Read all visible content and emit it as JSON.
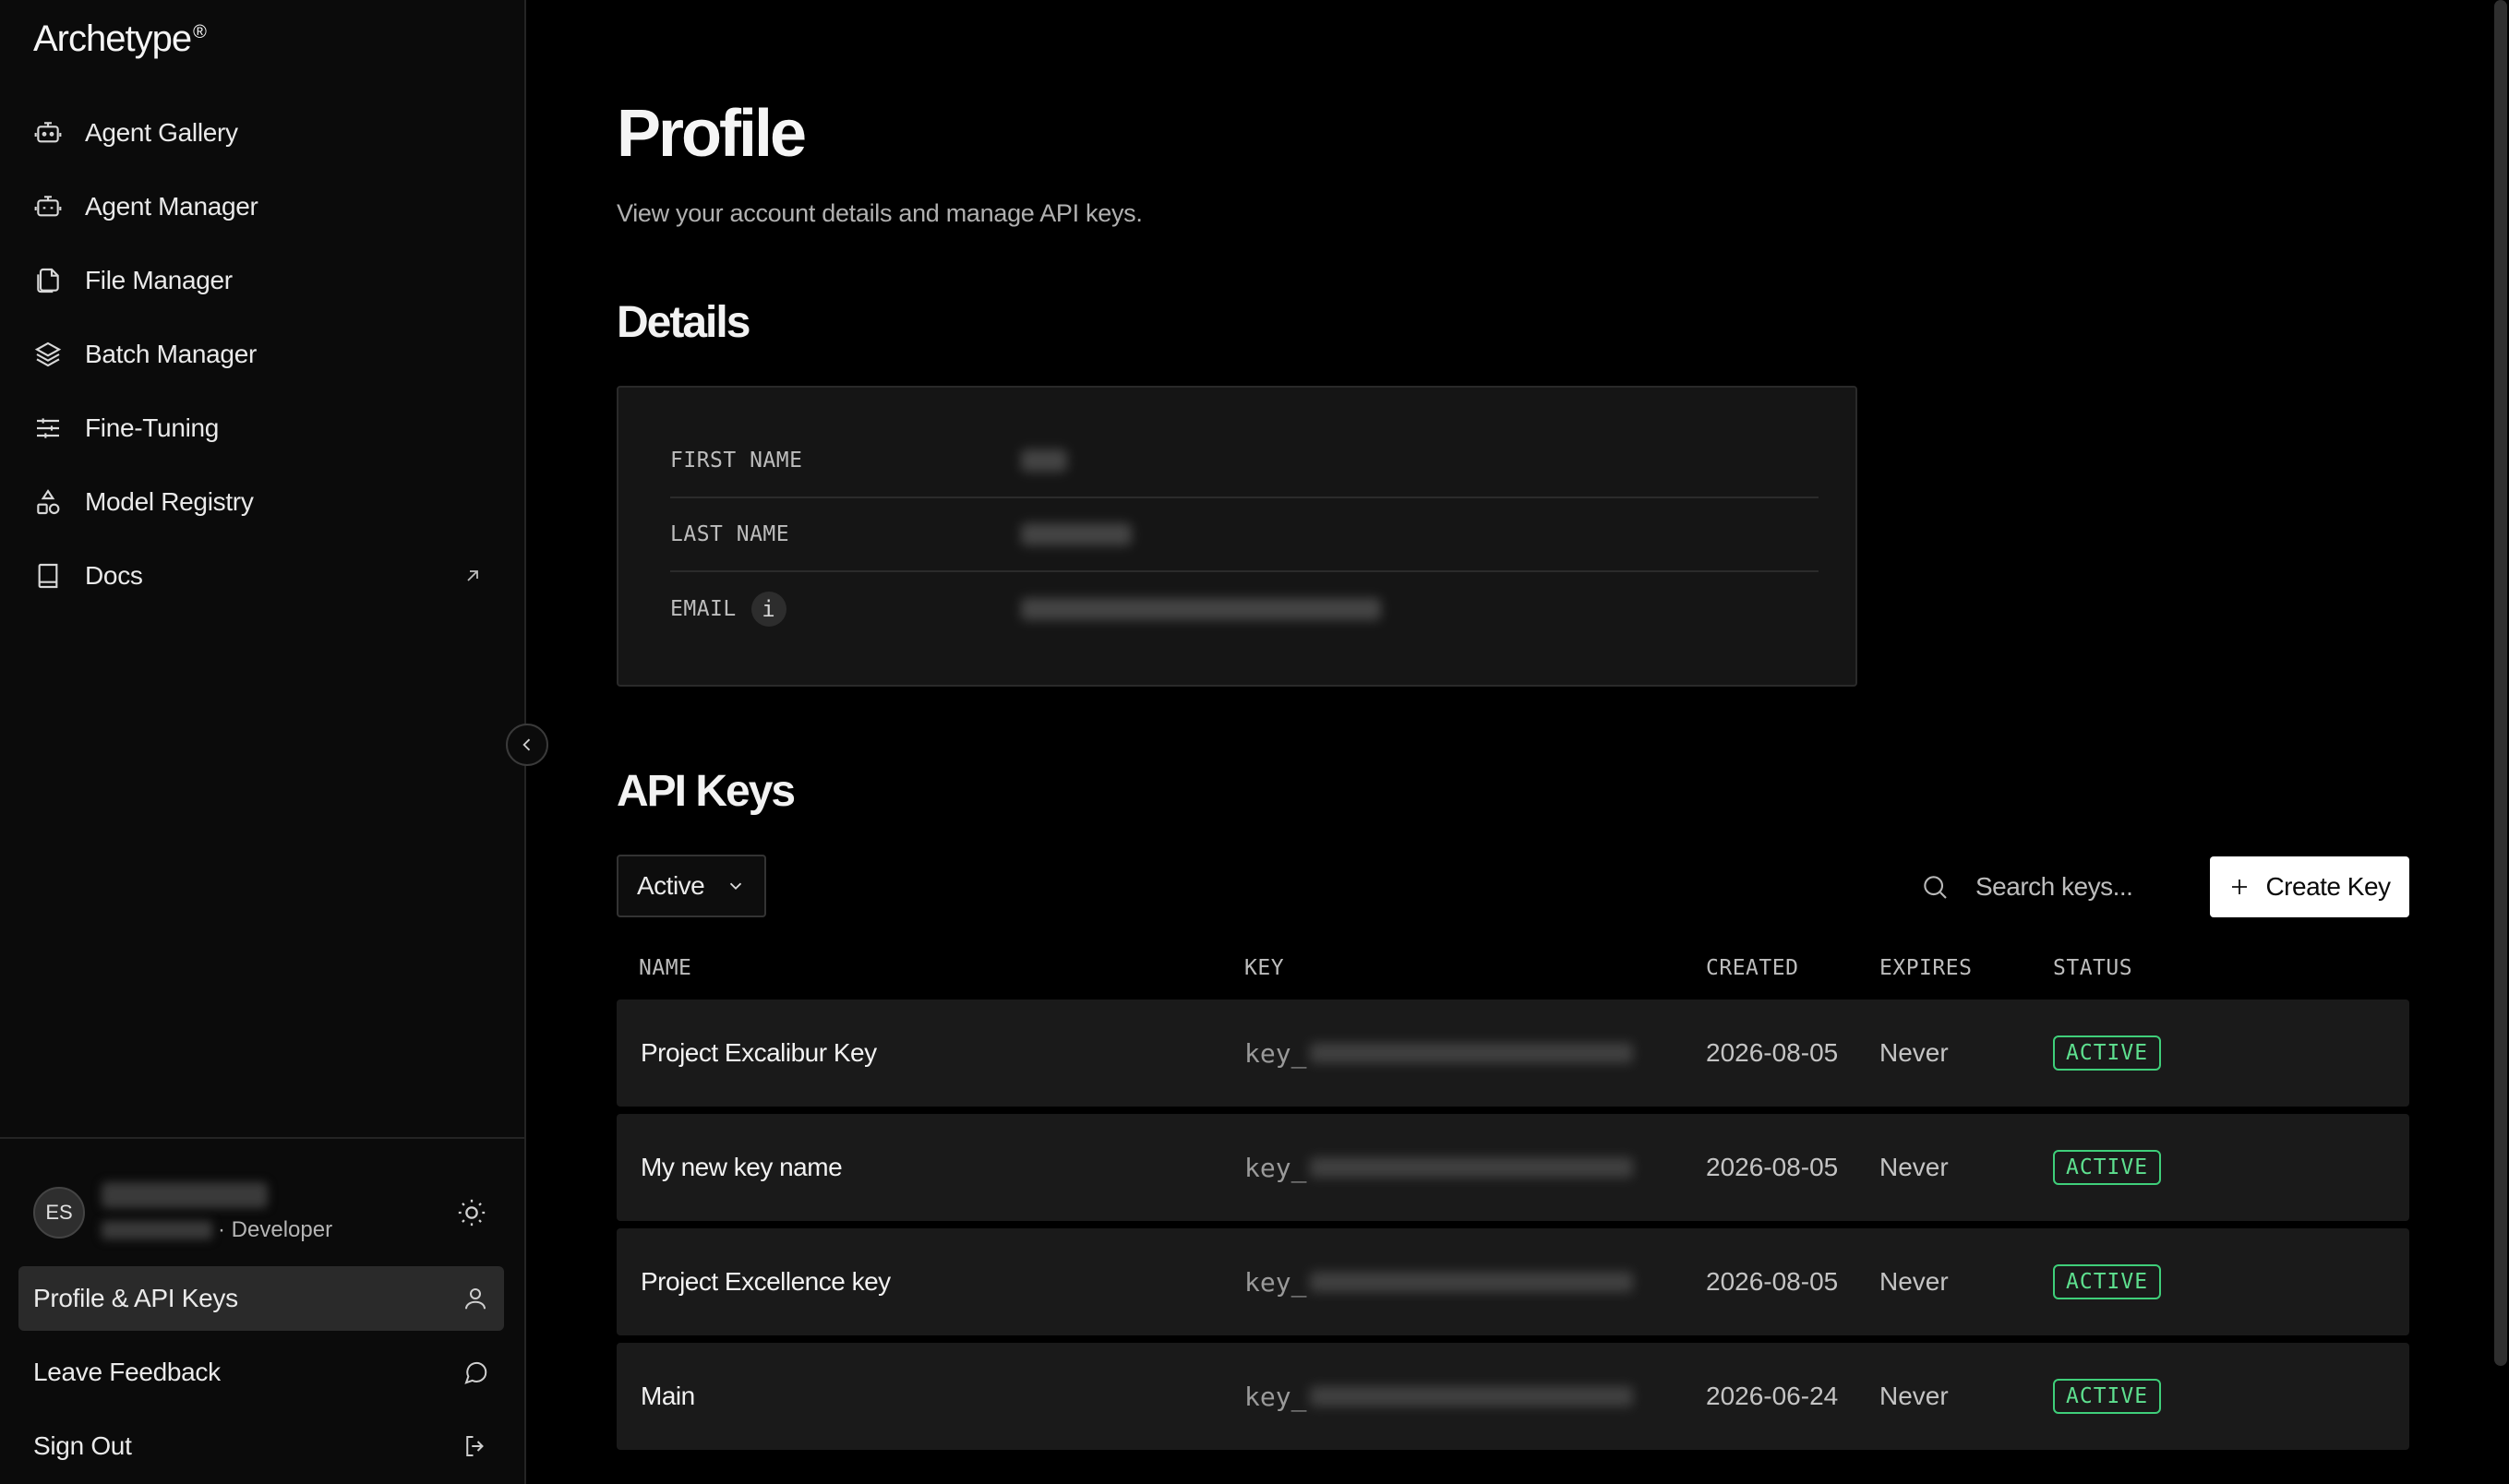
{
  "brand": {
    "name": "Archetype",
    "mark": "®"
  },
  "sidebar": {
    "items": [
      {
        "label": "Agent Gallery",
        "icon": "robot-icon"
      },
      {
        "label": "Agent Manager",
        "icon": "robot-settings-icon"
      },
      {
        "label": "File Manager",
        "icon": "files-icon"
      },
      {
        "label": "Batch Manager",
        "icon": "layers-icon"
      },
      {
        "label": "Fine-Tuning",
        "icon": "sliders-icon"
      },
      {
        "label": "Model Registry",
        "icon": "shapes-icon"
      },
      {
        "label": "Docs",
        "icon": "book-icon",
        "external": true
      }
    ],
    "user": {
      "initials": "ES",
      "role": "· Developer"
    },
    "bottom": {
      "profile_label": "Profile & API Keys",
      "feedback_label": "Leave Feedback",
      "signout_label": "Sign Out"
    }
  },
  "page": {
    "title": "Profile",
    "subtitle": "View your account details and manage API keys."
  },
  "details": {
    "title": "Details",
    "first_name_label": "FIRST NAME",
    "last_name_label": "LAST NAME",
    "email_label": "EMAIL",
    "info_glyph": "i"
  },
  "api_keys": {
    "title": "API Keys",
    "filter_value": "Active",
    "search_placeholder": "Search keys...",
    "create_label": "Create Key",
    "columns": {
      "name": "NAME",
      "key": "KEY",
      "created": "CREATED",
      "expires": "EXPIRES",
      "status": "STATUS"
    },
    "rows": [
      {
        "name": "Project Excalibur Key",
        "key_prefix": "key_",
        "created": "2026-08-05",
        "expires": "Never",
        "status": "ACTIVE"
      },
      {
        "name": "My new key name",
        "key_prefix": "key_",
        "created": "2026-08-05",
        "expires": "Never",
        "status": "ACTIVE"
      },
      {
        "name": "Project Excellence key",
        "key_prefix": "key_",
        "created": "2026-08-05",
        "expires": "Never",
        "status": "ACTIVE"
      },
      {
        "name": "Main",
        "key_prefix": "key_",
        "created": "2026-06-24",
        "expires": "Never",
        "status": "ACTIVE"
      }
    ]
  },
  "colors": {
    "background": "#000000",
    "sidebar": "#0b0b0b",
    "card": "#151515",
    "row": "#1a1a1a",
    "status_active": "#3fcf7a",
    "primary_button": "#ffffff"
  }
}
